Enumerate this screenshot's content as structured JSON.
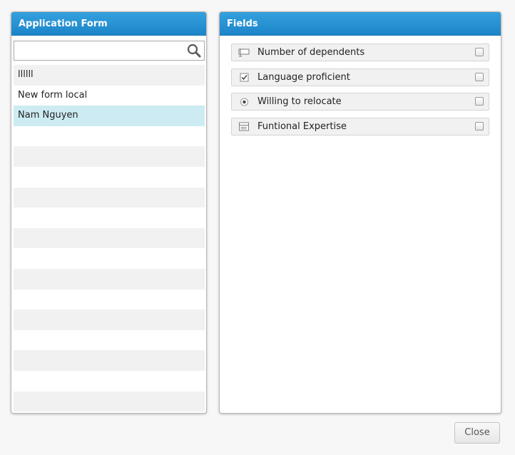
{
  "left_panel": {
    "title": "Application Form",
    "search": {
      "value": "",
      "placeholder": ""
    },
    "items": [
      {
        "label": "llllll",
        "state": "alt"
      },
      {
        "label": "New  form local",
        "state": "normal"
      },
      {
        "label": "Nam Nguyen",
        "state": "selected"
      },
      {
        "label": "",
        "state": "empty"
      },
      {
        "label": "",
        "state": "empty-alt"
      },
      {
        "label": "",
        "state": "empty"
      },
      {
        "label": "",
        "state": "empty-alt"
      },
      {
        "label": "",
        "state": "empty"
      },
      {
        "label": "",
        "state": "empty-alt"
      },
      {
        "label": "",
        "state": "empty"
      },
      {
        "label": "",
        "state": "empty-alt"
      },
      {
        "label": "",
        "state": "empty"
      },
      {
        "label": "",
        "state": "empty-alt"
      },
      {
        "label": "",
        "state": "empty"
      },
      {
        "label": "",
        "state": "empty-alt"
      },
      {
        "label": "",
        "state": "empty"
      },
      {
        "label": "",
        "state": "empty-alt"
      }
    ]
  },
  "right_panel": {
    "title": "Fields",
    "fields": [
      {
        "label": "Number of dependents",
        "icon": "numeric-field-icon",
        "checked": false
      },
      {
        "label": "Language proficient",
        "icon": "checkbox-field-icon",
        "checked": false
      },
      {
        "label": "Willing to relocate",
        "icon": "radio-field-icon",
        "checked": false
      },
      {
        "label": "Funtional Expertise",
        "icon": "dropdown-field-icon",
        "checked": false
      }
    ]
  },
  "footer": {
    "close_label": "Close"
  },
  "colors": {
    "header_blue": "#1c85c9",
    "selected_row": "#cdebf3",
    "alt_row": "#f1f1f1"
  }
}
